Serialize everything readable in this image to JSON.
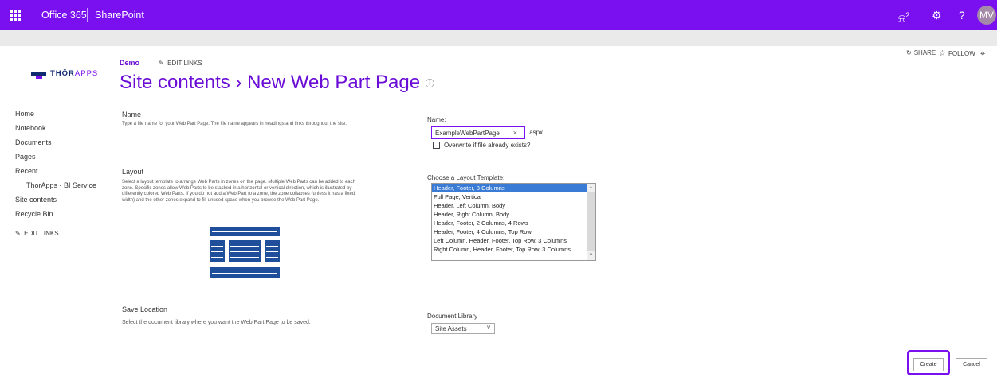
{
  "suite_bar": {
    "app_launcher_icon": "waffle-icon",
    "brand": "Office 365",
    "app": "SharePoint",
    "notification_count": "2",
    "avatar_initials": "MV",
    "accent_color": "#7a0ff0"
  },
  "actions": {
    "share": "SHARE",
    "follow": "FOLLOW"
  },
  "logo": {
    "part1": "THŌR",
    "part2": "APPS"
  },
  "breadcrumb": {
    "site": "Demo",
    "edit_links": "EDIT LINKS"
  },
  "page_title": "Site contents › New Web Part Page",
  "nav": {
    "items": [
      "Home",
      "Notebook",
      "Documents",
      "Pages",
      "Recent"
    ],
    "recent_child": "ThorApps - BI Service",
    "items2": [
      "Site contents",
      "Recycle Bin"
    ],
    "edit_links": "EDIT LINKS"
  },
  "sections": {
    "name": {
      "heading": "Name",
      "description": "Type a file name for your Web Part Page.  The file name appears in headings and links throughout the site."
    },
    "layout": {
      "heading": "Layout",
      "description": "Select a layout template to arrange Web Parts in zones on the page. Multiple Web Parts can be added to each zone. Specific zones allow Web Parts to be stacked in a horizontal or vertical direction, which is illustrated by differently colored Web Parts. If you do not add a Web Part to a zone, the zone collapses (unless it has a fixed width) and the other zones expand to fill unused space when you browse the Web Part Page."
    },
    "save": {
      "heading": "Save Location",
      "description": "Select the document library where you want the Web Part Page to be saved."
    }
  },
  "form": {
    "name_label": "Name:",
    "name_value": "ExampleWebPartPage",
    "extension": ".aspx",
    "overwrite_label": "Overwrite if file already exists?",
    "overwrite_checked": false,
    "layout_label": "Choose a Layout Template:",
    "layout_options": [
      "Header, Footer, 3 Columns",
      "Full Page, Vertical",
      "Header, Left Column, Body",
      "Header, Right Column, Body",
      "Header, Footer, 2 Columns, 4 Rows",
      "Header, Footer, 4 Columns, Top Row",
      "Left Column, Header, Footer, Top Row, 3 Columns",
      "Right Column, Header, Footer, Top Row, 3 Columns"
    ],
    "layout_selected_index": 0,
    "doclib_label": "Document Library",
    "doclib_value": "Site Assets"
  },
  "buttons": {
    "create": "Create",
    "cancel": "Cancel"
  }
}
